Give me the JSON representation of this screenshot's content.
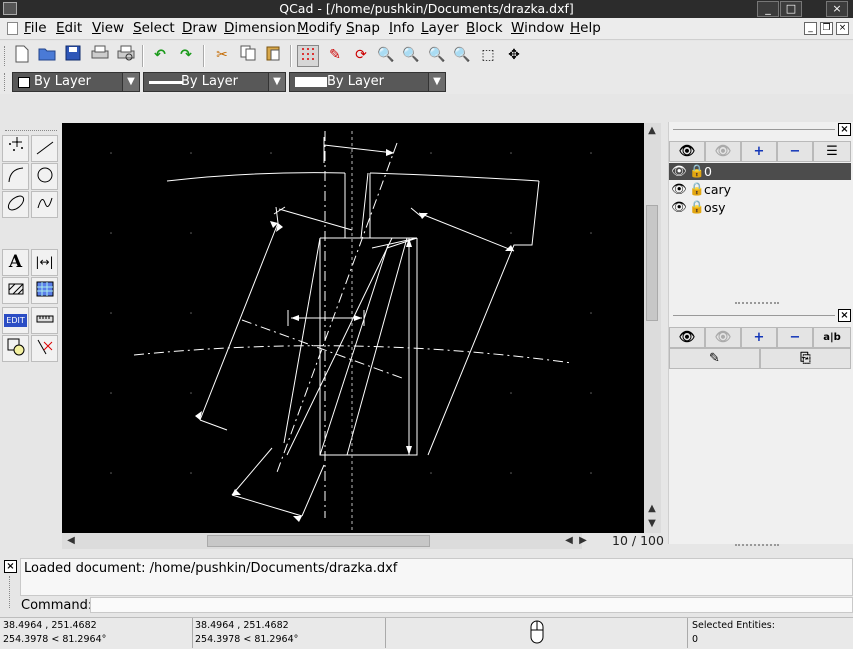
{
  "window": {
    "title": "QCad - [/home/pushkin/Documents/drazka.dxf]",
    "buttons": [
      "_",
      "□",
      "×"
    ]
  },
  "menubar": {
    "items": [
      {
        "label": "File",
        "u": "F",
        "rest": "ile"
      },
      {
        "label": "Edit",
        "u": "E",
        "rest": "dit"
      },
      {
        "label": "View",
        "u": "V",
        "rest": "iew"
      },
      {
        "label": "Select",
        "u": "S",
        "rest": "elect"
      },
      {
        "label": "Draw",
        "u": "D",
        "rest": "raw"
      },
      {
        "label": "Dimension",
        "u": "D",
        "rest": "imension"
      },
      {
        "label": "Modify",
        "u": "M",
        "rest": "odify"
      },
      {
        "label": "Snap",
        "u": "S",
        "rest": "nap"
      },
      {
        "label": "Info",
        "u": "I",
        "rest": "nfo"
      },
      {
        "label": "Layer",
        "u": "L",
        "rest": "ayer"
      },
      {
        "label": "Block",
        "u": "B",
        "rest": "lock"
      },
      {
        "label": "Window",
        "u": "W",
        "rest": "indow"
      },
      {
        "label": "Help",
        "u": "H",
        "rest": "elp"
      }
    ]
  },
  "toolbar": {
    "icons": [
      "new-file-icon",
      "open-file-icon",
      "save-file-icon",
      "print-icon",
      "print-preview-icon",
      "undo-icon",
      "redo-icon",
      "cut-icon",
      "copy-icon",
      "paste-icon",
      "grid-icon",
      "draft-mode-icon",
      "redraw-icon",
      "zoom-in-icon",
      "zoom-out-icon",
      "zoom-auto-icon",
      "zoom-previous-icon",
      "zoom-window-icon",
      "pan-icon"
    ]
  },
  "pen": {
    "color": "By Layer",
    "width": "By Layer",
    "linetype": "By Layer"
  },
  "tools": {
    "icons": [
      "points-tool-icon",
      "lines-tool-icon",
      "arcs-tool-icon",
      "circles-tool-icon",
      "ellipses-tool-icon",
      "splines-tool-icon",
      "text-tool-icon",
      "dimensions-tool-icon",
      "hatch-tool-icon",
      "image-tool-icon",
      "edit-tool-icon",
      "measure-tool-icon",
      "select-tool-icon",
      "snap-tool-icon"
    ],
    "edit_label": "EDIT"
  },
  "canvas": {
    "background": "#000000",
    "page_info": "10 / 100"
  },
  "layers": {
    "items": [
      {
        "name": "0",
        "selected": true
      },
      {
        "name": "cary",
        "selected": false
      },
      {
        "name": "osy",
        "selected": false
      }
    ]
  },
  "command": {
    "history": "Loaded document: /home/pushkin/Documents/drazka.dxf",
    "prompt": "Command:"
  },
  "status": {
    "abs_coord": "38.4964 , 251.4682",
    "abs_polar": "254.3978 < 81.2964°",
    "rel_coord": "38.4964 , 251.4682",
    "rel_polar": "254.3978 < 81.2964°",
    "selected_label": "Selected Entities:",
    "selected_count": "0"
  }
}
